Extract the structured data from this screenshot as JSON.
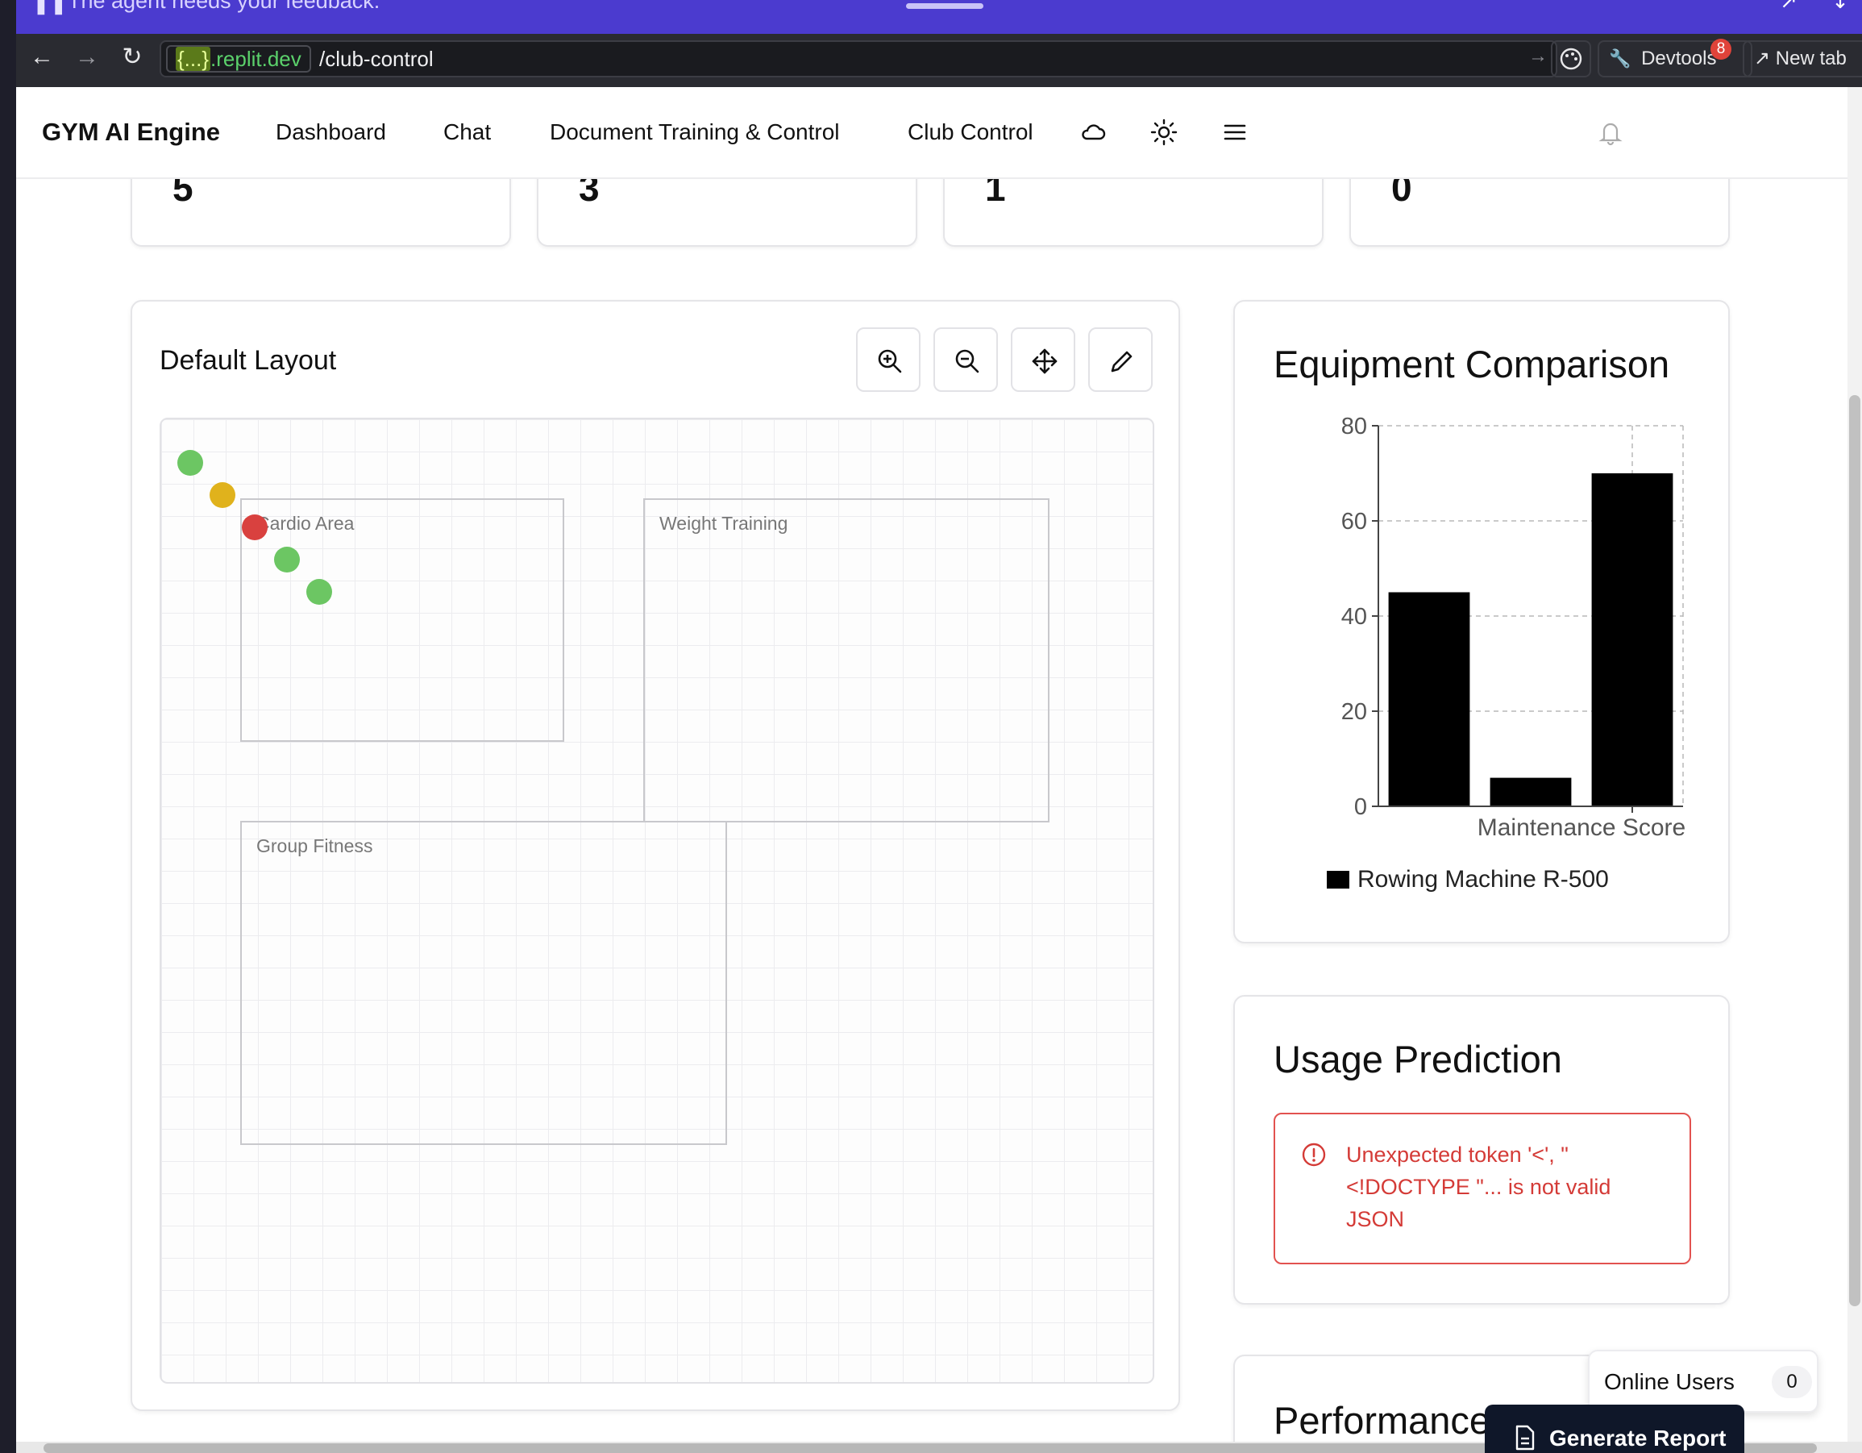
{
  "banner": {
    "message": "The agent needs your feedback."
  },
  "browser": {
    "host_brace": "{...}",
    "host_rest": ".replit.dev",
    "path": "/club-control",
    "devtools_label": "Devtools",
    "devtools_badge": "8",
    "new_tab_label": "New tab"
  },
  "app": {
    "brand": "GYM AI Engine",
    "nav": [
      "Dashboard",
      "Chat",
      "Document Training & Control",
      "Club Control"
    ]
  },
  "stats": [
    "5",
    "3",
    "1",
    "0"
  ],
  "layout": {
    "title": "Default Layout",
    "zones": [
      "Cardio Area",
      "Weight Training",
      "Group Fitness"
    ],
    "equipment_status": [
      "green",
      "yellow",
      "red",
      "green",
      "green"
    ],
    "colors": {
      "green": "#6cc663",
      "yellow": "#e0b21c",
      "red": "#d9413f"
    }
  },
  "comparison": {
    "title": "Equipment Comparison"
  },
  "chart_data": {
    "type": "bar",
    "title": "Equipment Comparison",
    "xlabel": "Maintenance Score",
    "ylabel": "",
    "ylim": [
      0,
      80
    ],
    "yticks": [
      0,
      20,
      40,
      60,
      80
    ],
    "grid": "dashed",
    "legend_position": "bottom",
    "series": [
      {
        "name": "Rowing Machine R-500",
        "values": [
          45,
          6,
          70
        ],
        "color": "#000000"
      }
    ]
  },
  "prediction": {
    "title": "Usage Prediction",
    "error": "Unexpected token '<', \"<!DOCTYPE \"... is not valid JSON"
  },
  "performance": {
    "title": "Performance"
  },
  "online": {
    "label": "Online Users",
    "count": "0"
  },
  "report": {
    "label": "Generate Report"
  }
}
